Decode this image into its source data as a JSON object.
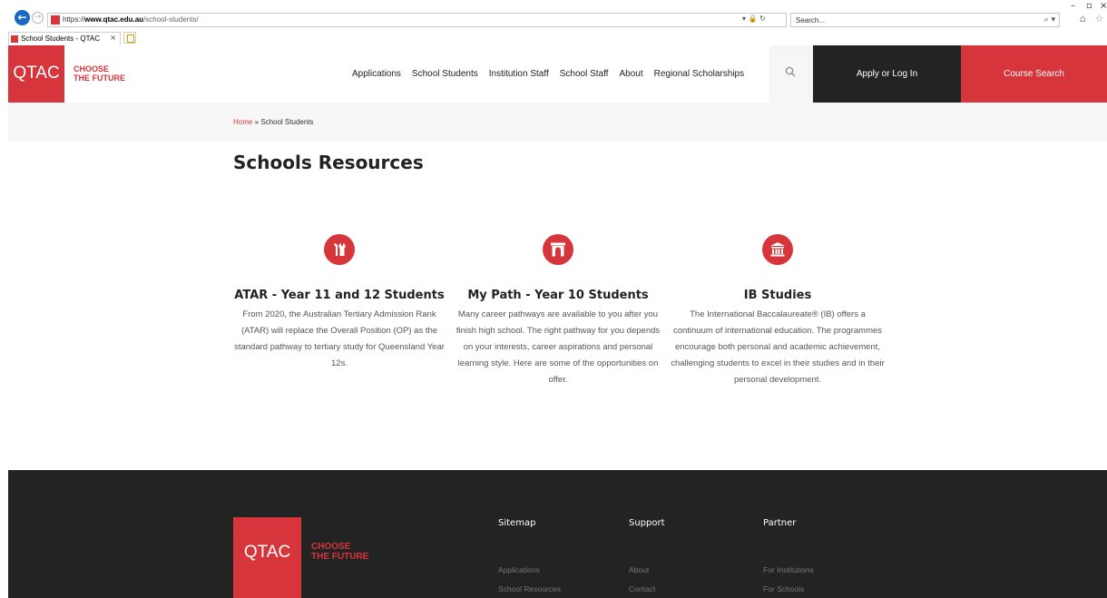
{
  "browser": {
    "url_scheme": "https://",
    "url_host": "www.qtac.edu.au",
    "url_path": "/school-students/",
    "addr_icons": "▾ 🔒 ↻",
    "search_placeholder": "Search...",
    "search_icon": "⌕ ▾",
    "tab_title": "School Students - QTAC",
    "tab_close": "×",
    "min_btn": "–",
    "restore_btn": "▫",
    "close_btn": "×",
    "right_icons": "⌂ ☆"
  },
  "header": {
    "logo": "QTAC",
    "tagline_line1": "CHOOSE",
    "tagline_line2": "THE FUTURE",
    "nav": [
      "Applications",
      "School Students",
      "Institution Staff",
      "School Staff",
      "About",
      "Regional Scholarships"
    ],
    "search_icon": "⚲",
    "apply_label": "Apply or Log In",
    "course_search_label": "Course Search"
  },
  "breadcrumb": {
    "home": "Home",
    "sep": " » ",
    "current": "School Students"
  },
  "page": {
    "title": "Schools Resources"
  },
  "cards": [
    {
      "icon": "tools-icon",
      "title": "ATAR - Year 11 and 12 Students",
      "description": "From 2020, the Australian Tertiary Admission Rank (ATAR) will replace the Overall Position (OP) as the standard pathway to tertiary study for Queensland Year 12s."
    },
    {
      "icon": "archway-icon",
      "title": "My Path - Year 10 Students",
      "description": "Many career pathways are available to you after you finish high school. The right pathway for you depends on your interests, career aspirations and personal learning style. Here are some of the opportunities on offer."
    },
    {
      "icon": "institution-icon",
      "title": "IB Studies",
      "description": "The International Baccalaureate® (IB) offers a continuum of international education. The programmes encourage both personal and academic achievement, challenging students to excel in their studies and in their personal development."
    }
  ],
  "footer": {
    "logo": "QTAC",
    "tagline_line1": "CHOOSE",
    "tagline_line2": "THE FUTURE",
    "columns": [
      {
        "heading": "Sitemap",
        "links": [
          "Applications",
          "School Resources"
        ]
      },
      {
        "heading": "Support",
        "links": [
          "About",
          "Contact"
        ]
      },
      {
        "heading": "Partner",
        "links": [
          "For Institutions",
          "For Schools"
        ]
      }
    ]
  },
  "colors": {
    "brand_red": "#d6353b",
    "dark": "#232323",
    "link_blue": "#1769c4"
  }
}
